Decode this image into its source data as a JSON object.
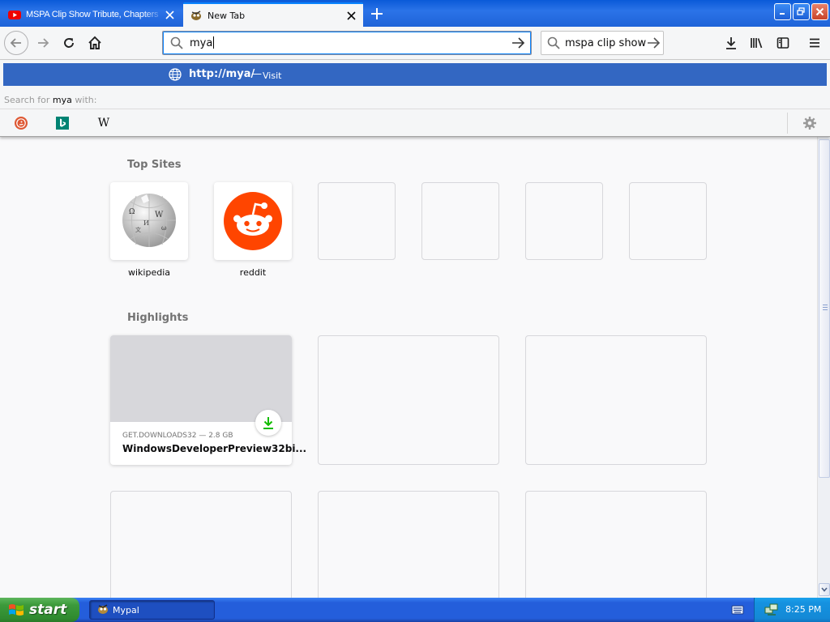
{
  "tabs": [
    {
      "label": "MSPA Clip Show Tribute, Chapters",
      "favicon": "youtube-icon",
      "active": false
    },
    {
      "label": "New Tab",
      "favicon": "mypal-icon",
      "active": true
    }
  ],
  "navbar": {
    "url_value": "mya",
    "search_value": "mspa clip show"
  },
  "dropdown": {
    "result_url": "http://mya/",
    "result_sep": "—",
    "result_action": "Visit",
    "search_with_prefix": "Search for",
    "search_with_term": "mya",
    "search_with_suffix": "with:",
    "engines": [
      {
        "name": "DuckDuckGo",
        "icon": "duckduckgo-icon"
      },
      {
        "name": "Bing",
        "icon": "bing-icon"
      },
      {
        "name": "Wikipedia",
        "icon": "wikipedia-icon",
        "glyph": "W"
      }
    ]
  },
  "newtab": {
    "top_sites_title": "Top Sites",
    "top_sites": [
      {
        "label": "wikipedia",
        "icon": "wikipedia-globe-icon"
      },
      {
        "label": "reddit",
        "icon": "reddit-icon"
      }
    ],
    "highlights_title": "Highlights",
    "highlight": {
      "source": "GET.DOWNLOADS32 — 2.8 GB",
      "title": "WindowsDeveloperPreview32bi..."
    }
  },
  "taskbar": {
    "start_label": "start",
    "task_label": "Mypal",
    "clock": "8:25 PM"
  },
  "colors": {
    "accent": "#0a84ff",
    "result_highlight": "#3367c2",
    "reddit": "#ff4500",
    "download_green": "#12bc00"
  }
}
